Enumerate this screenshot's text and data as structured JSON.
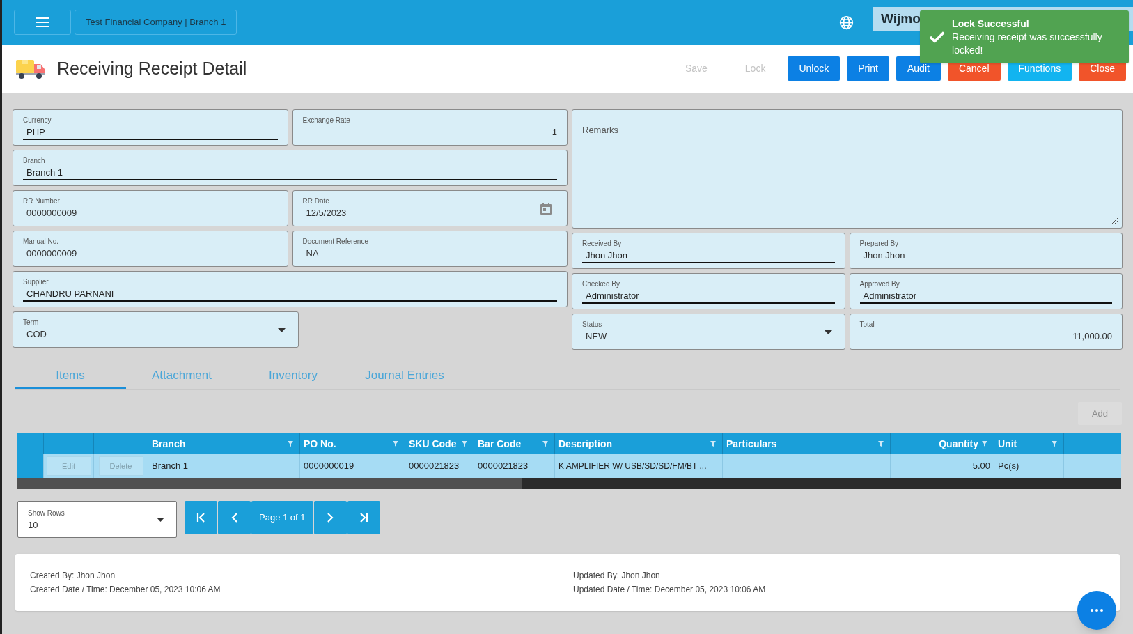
{
  "header": {
    "company": "Test Financial Company | Branch 1",
    "account_text": "Wijmo"
  },
  "toast": {
    "title": "Lock Successful",
    "message": "Receiving receipt was successfully locked!"
  },
  "page": {
    "title": "Receiving Receipt Detail"
  },
  "toolbar": [
    {
      "label": "Save",
      "kind": "disabled"
    },
    {
      "label": "Lock",
      "kind": "disabled"
    },
    {
      "label": "Unlock",
      "kind": "primary"
    },
    {
      "label": "Print",
      "kind": "primary"
    },
    {
      "label": "Audit",
      "kind": "primary"
    },
    {
      "label": "Cancel",
      "kind": "danger"
    },
    {
      "label": "Functions",
      "kind": "info"
    },
    {
      "label": "Close",
      "kind": "danger"
    }
  ],
  "left_rows": [
    [
      {
        "label": "Currency",
        "value": "PHP",
        "kind": "underline"
      },
      {
        "label": "Exchange Rate",
        "value": "1",
        "kind": "number"
      }
    ],
    [
      {
        "label": "Branch",
        "value": "Branch 1",
        "kind": "underline"
      }
    ],
    [
      {
        "label": "RR Number",
        "value": "0000000009",
        "kind": "plain"
      },
      {
        "label": "RR Date",
        "value": "12/5/2023",
        "kind": "date"
      }
    ],
    [
      {
        "label": "Manual No.",
        "value": "0000000009",
        "kind": "plain"
      },
      {
        "label": "Document Reference",
        "value": "NA",
        "kind": "plain"
      }
    ],
    [
      {
        "label": "Supplier",
        "value": "CHANDRU PARNANI",
        "kind": "underline"
      }
    ],
    [
      {
        "label": "Term",
        "value": "COD",
        "kind": "select"
      }
    ]
  ],
  "remarks": {
    "label": "Remarks"
  },
  "right_rows": [
    [
      {
        "label": "Received By",
        "value": "Jhon Jhon",
        "kind": "underline"
      },
      {
        "label": "Prepared By",
        "value": "Jhon Jhon",
        "kind": "plain"
      }
    ],
    [
      {
        "label": "Checked By",
        "value": "Administrator",
        "kind": "underline"
      },
      {
        "label": "Approved By",
        "value": "Administrator",
        "kind": "underline"
      }
    ],
    [
      {
        "label": "Status",
        "value": "NEW",
        "kind": "select"
      },
      {
        "label": "Total",
        "value": "11,000.00",
        "kind": "number"
      }
    ]
  ],
  "tabs": [
    {
      "label": "Items",
      "selected": true
    },
    {
      "label": "Attachment",
      "selected": false
    },
    {
      "label": "Inventory",
      "selected": false
    },
    {
      "label": "Journal Entries",
      "selected": false
    }
  ],
  "add_button": "Add",
  "table": {
    "columns": [
      "Branch",
      "PO No.",
      "SKU Code",
      "Bar Code",
      "Description",
      "Particulars",
      "Quantity",
      "Unit"
    ],
    "rows": [
      {
        "actions": [
          "Edit",
          "Delete"
        ],
        "cells": [
          "Branch 1",
          "0000000019",
          "0000021823",
          "0000021823",
          "K AMPLIFIER W/ USB/SD/SD/FM/BT ...",
          "",
          "5.00",
          "Pc(s)"
        ]
      }
    ]
  },
  "pager": {
    "show_rows_label": "Show Rows",
    "show_rows_value": "10",
    "page_label": "Page 1 of 1"
  },
  "footer": {
    "created_by": "Created By: Jhon Jhon",
    "created_date": "Created Date / Time: December 05, 2023 10:06 AM",
    "updated_by": "Updated By: Jhon Jhon",
    "updated_date": "Updated Date / Time: December 05, 2023 10:06 AM"
  }
}
